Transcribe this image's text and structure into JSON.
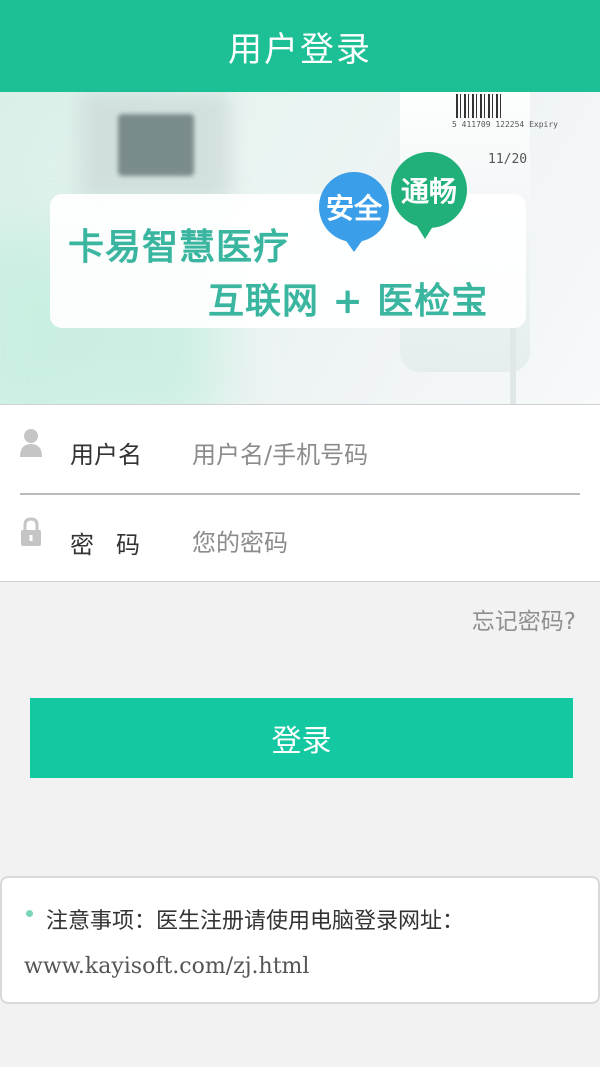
{
  "header": {
    "title": "用户登录"
  },
  "banner": {
    "slogan_line1": "卡易智慧医疗",
    "slogan_line2": "互联网 + 医检宝",
    "bubble_left": "安全",
    "bubble_right": "通畅",
    "bag_text_small": "5 411709 122254  Expiry",
    "bag_text_large": "11/20",
    "colors": {
      "bubble_left": "#3a9ee8",
      "bubble_right": "#21b07a",
      "slogan": "#3ab5a0"
    }
  },
  "form": {
    "username": {
      "icon": "user-icon",
      "label": "用户名",
      "placeholder": "用户名/手机号码",
      "value": ""
    },
    "password": {
      "icon": "lock-icon",
      "label": "密码",
      "placeholder": "您的密码",
      "value": ""
    }
  },
  "forgot_link": "忘记密码?",
  "login_button": {
    "label": "登录",
    "color": "#14c9a2"
  },
  "notice": {
    "title": "注意事项：医生注册请使用电脑登录网址：",
    "url": "www.kayisoft.com/zj.html"
  },
  "theme": {
    "primary": "#1dbf95"
  }
}
